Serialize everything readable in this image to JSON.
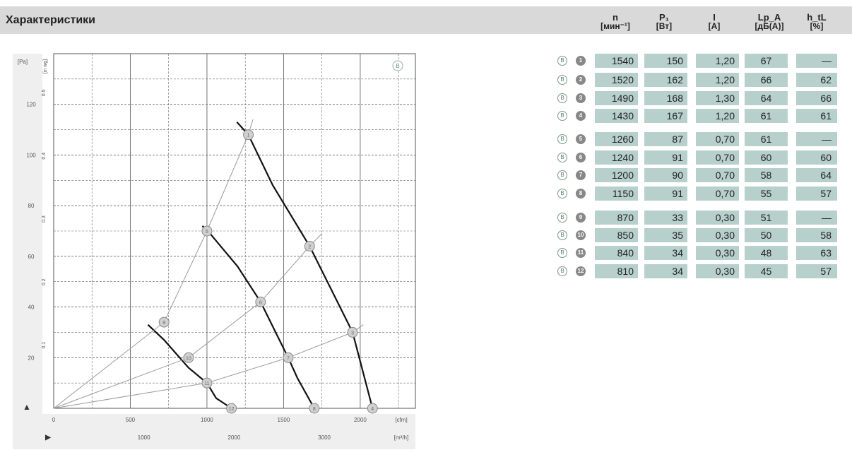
{
  "header": {
    "title": "Характеристики"
  },
  "table": {
    "columns": [
      {
        "name": "n",
        "unit": "[мин⁻¹]"
      },
      {
        "name": "P₁",
        "unit": "[Вт]"
      },
      {
        "name": "I",
        "unit": "[A]"
      },
      {
        "name": "Lp_A",
        "unit": "[дБ(A)]"
      },
      {
        "name": "h_tL",
        "unit": "[%]"
      }
    ],
    "code_letter": "B",
    "rows": [
      {
        "num": "1",
        "n": "1540",
        "p": "150",
        "i": "1,20",
        "lp": "67",
        "h": "—"
      },
      {
        "num": "2",
        "n": "1520",
        "p": "162",
        "i": "1,20",
        "lp": "66",
        "h": "62"
      },
      {
        "num": "3",
        "n": "1490",
        "p": "168",
        "i": "1,30",
        "lp": "64",
        "h": "66"
      },
      {
        "num": "4",
        "n": "1430",
        "p": "167",
        "i": "1,20",
        "lp": "61",
        "h": "61"
      },
      {
        "num": "5",
        "n": "1260",
        "p": "87",
        "i": "0,70",
        "lp": "61",
        "h": "—"
      },
      {
        "num": "6",
        "n": "1240",
        "p": "91",
        "i": "0,70",
        "lp": "60",
        "h": "60"
      },
      {
        "num": "7",
        "n": "1200",
        "p": "90",
        "i": "0,70",
        "lp": "58",
        "h": "64"
      },
      {
        "num": "8",
        "n": "1150",
        "p": "91",
        "i": "0,70",
        "lp": "55",
        "h": "57"
      },
      {
        "num": "9",
        "n": "870",
        "p": "33",
        "i": "0,30",
        "lp": "51",
        "h": "—"
      },
      {
        "num": "10",
        "n": "850",
        "p": "35",
        "i": "0,30",
        "lp": "50",
        "h": "58"
      },
      {
        "num": "11",
        "n": "840",
        "p": "34",
        "i": "0,30",
        "lp": "48",
        "h": "63"
      },
      {
        "num": "12",
        "n": "810",
        "p": "34",
        "i": "0,30",
        "lp": "45",
        "h": "57"
      }
    ]
  },
  "chart_data": {
    "type": "line",
    "title": "",
    "curve_label": "B",
    "x_primary": {
      "unit": "[cfm]",
      "ticks": [
        "0",
        "500",
        "1000",
        "1500",
        "2000"
      ],
      "range": [
        0,
        2360
      ]
    },
    "x_secondary": {
      "unit": "[m³/h]",
      "ticks": [
        "1000",
        "2000",
        "3000"
      ],
      "factor_m3h_per_cfm": 1.699
    },
    "y_primary": {
      "unit": "[Pa]",
      "ticks": [
        "20",
        "40",
        "60",
        "80",
        "100",
        "120"
      ],
      "range": [
        0,
        140
      ]
    },
    "y_secondary": {
      "unit": "[in wg]",
      "ticks": [
        "0.1",
        "0.2",
        "0.3",
        "0.4",
        "0.5"
      ]
    },
    "grid": true,
    "series": [
      {
        "name": "",
        "type": "fan-curve",
        "points": [
          [
            615,
            33
          ],
          [
            720,
            27
          ],
          [
            880,
            16
          ],
          [
            1000,
            10
          ],
          [
            1060,
            4
          ],
          [
            1160,
            0
          ]
        ]
      },
      {
        "name": "",
        "type": "fan-curve",
        "points": [
          [
            970,
            72
          ],
          [
            1020,
            69
          ],
          [
            1200,
            56
          ],
          [
            1350,
            42
          ],
          [
            1530,
            20
          ],
          [
            1590,
            12
          ],
          [
            1700,
            0
          ]
        ]
      },
      {
        "name": "",
        "type": "fan-curve",
        "points": [
          [
            1195,
            113
          ],
          [
            1270,
            108
          ],
          [
            1430,
            88
          ],
          [
            1670,
            64
          ],
          [
            1950,
            30
          ],
          [
            2080,
            0
          ]
        ]
      },
      {
        "name": "",
        "type": "system-curve",
        "points": [
          [
            0,
            0
          ],
          [
            720,
            34
          ],
          [
            1000,
            70
          ],
          [
            1270,
            108
          ],
          [
            1300,
            114
          ]
        ]
      },
      {
        "name": "",
        "type": "system-curve",
        "points": [
          [
            0,
            0
          ],
          [
            880,
            20
          ],
          [
            1350,
            42
          ],
          [
            1670,
            64
          ],
          [
            1750,
            69
          ]
        ]
      },
      {
        "name": "",
        "type": "system-curve",
        "points": [
          [
            0,
            0
          ],
          [
            1000,
            10
          ],
          [
            1530,
            20
          ],
          [
            1950,
            30
          ],
          [
            2020,
            33
          ]
        ]
      }
    ],
    "operating_points": [
      {
        "num": "1",
        "q": 1270,
        "p": 108
      },
      {
        "num": "2",
        "q": 1670,
        "p": 64
      },
      {
        "num": "3",
        "q": 1950,
        "p": 30
      },
      {
        "num": "4",
        "q": 2080,
        "p": 0
      },
      {
        "num": "5",
        "q": 1000,
        "p": 70
      },
      {
        "num": "6",
        "q": 1350,
        "p": 42
      },
      {
        "num": "7",
        "q": 1530,
        "p": 20
      },
      {
        "num": "8",
        "q": 1700,
        "p": 0
      },
      {
        "num": "9",
        "q": 720,
        "p": 34
      },
      {
        "num": "10",
        "q": 880,
        "p": 20
      },
      {
        "num": "11",
        "q": 1000,
        "p": 10
      },
      {
        "num": "12",
        "q": 1160,
        "p": 0
      }
    ]
  },
  "colors": {
    "header_bar": "#d9d9d9",
    "cell_fill": "#b7d0cb",
    "grid": "#555555",
    "fan_curve": "#111111",
    "system_curve": "#9a9a9a"
  }
}
